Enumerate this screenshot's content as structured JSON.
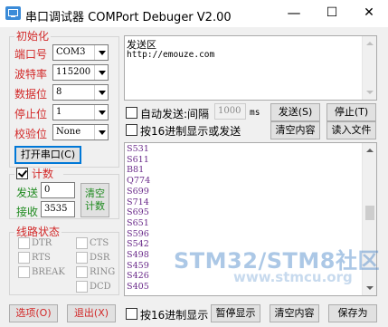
{
  "window": {
    "title": "串口调试器 COMPort Debuger V2.00",
    "minimize_glyph": "—",
    "maximize_glyph": "☐",
    "close_glyph": "✕"
  },
  "init": {
    "group_title": "初始化",
    "port_label": "端口号",
    "port_value": "COM3",
    "baud_label": "波特率",
    "baud_value": "115200",
    "databits_label": "数据位",
    "databits_value": "8",
    "stopbits_label": "停止位",
    "stopbits_value": "1",
    "parity_label": "校验位",
    "parity_value": "None",
    "open_button": "打开串口(C)"
  },
  "count": {
    "group_title": "计数",
    "checked": true,
    "send_label": "发送",
    "send_value": "0",
    "recv_label": "接收",
    "recv_value": "3535",
    "clear_line1": "清空",
    "clear_line2": "计数"
  },
  "line_status": {
    "group_title": "线路状态",
    "left": [
      "DTR",
      "RTS",
      "BREAK"
    ],
    "right": [
      "CTS",
      "DSR",
      "RING",
      "DCD"
    ]
  },
  "send": {
    "area_title": "发送区",
    "content": "http://emouze.com",
    "auto_send_label": "自动发送:间隔",
    "interval_value": "1000",
    "interval_unit": "ms",
    "send_button": "发送(S)",
    "stop_button": "停止(T)",
    "hex_send_label": "按16进制显示或发送",
    "clear_button": "清空内容",
    "read_file_button": "读入文件"
  },
  "receive": {
    "lines": [
      "S531",
      "S611",
      "B81",
      "Q774",
      "S699",
      "S714",
      "S695",
      "S651",
      "S596",
      "S542",
      "S498",
      "S459",
      "S426",
      "S405"
    ],
    "hex_display_label": "按16进制显示",
    "pause_button": "暂停显示",
    "clear_button": "清空内容",
    "save_button": "保存为"
  },
  "footer": {
    "options_button": "选项(O)",
    "exit_button": "退出(X)"
  },
  "watermark": {
    "main": "STM32/STM8社区",
    "sub": "www.stmcu.org"
  },
  "colors": {
    "label_red": "#d22828",
    "receive_text": "#6a2a8a",
    "watermark_blue": "#4a86c8"
  }
}
